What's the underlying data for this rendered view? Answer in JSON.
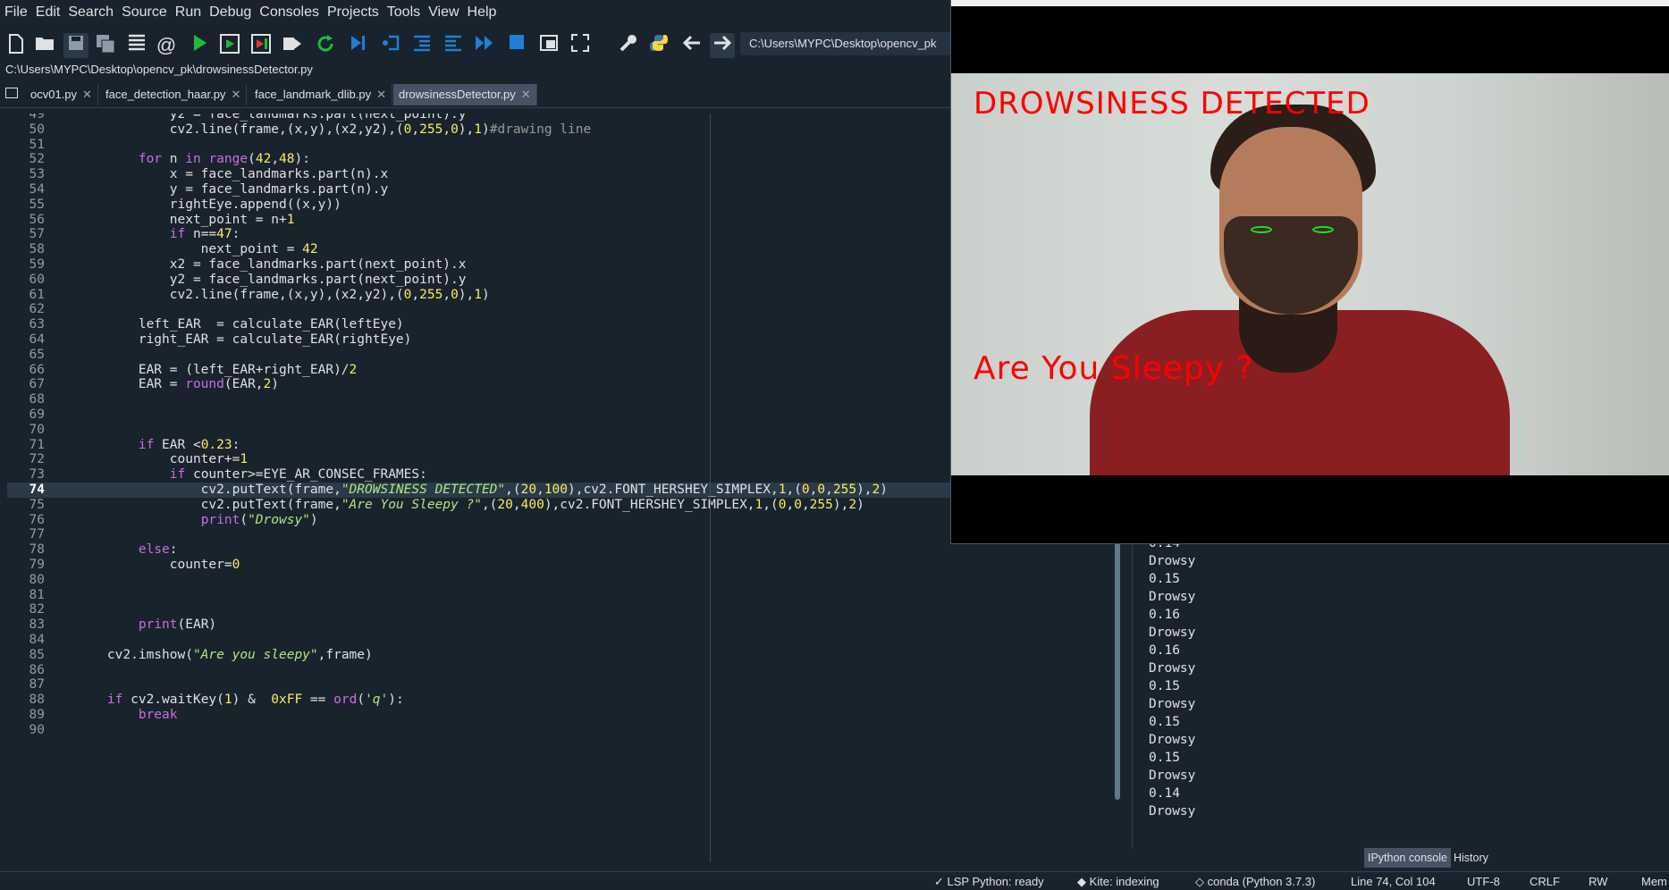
{
  "menu": [
    "File",
    "Edit",
    "Search",
    "Source",
    "Run",
    "Debug",
    "Consoles",
    "Projects",
    "Tools",
    "View",
    "Help"
  ],
  "toolbar": {
    "path": "C:\\Users\\MYPC\\Desktop\\opencv_pk"
  },
  "file_path": "C:\\Users\\MYPC\\Desktop\\opencv_pk\\drowsinessDetector.py",
  "tabs": [
    {
      "label": "ocv01.py"
    },
    {
      "label": "face_detection_haar.py"
    },
    {
      "label": "face_landmark_dlib.py"
    },
    {
      "label": "drowsinessDetector.py"
    }
  ],
  "tab_close": "✕",
  "editor": {
    "current_line": 74,
    "lines": [
      {
        "n": "49",
        "t": "            y2 = face_landmarks.part(next_point).y"
      },
      {
        "n": "50",
        "t": "            cv2.line(frame,(x,y),(x2,y2),(0,255,0),1)#drawing line"
      },
      {
        "n": "51",
        "t": ""
      },
      {
        "n": "52",
        "t": "        for n in range(42,48):"
      },
      {
        "n": "53",
        "t": "            x = face_landmarks.part(n).x"
      },
      {
        "n": "54",
        "t": "            y = face_landmarks.part(n).y"
      },
      {
        "n": "55",
        "t": "            rightEye.append((x,y))"
      },
      {
        "n": "56",
        "t": "            next_point = n+1"
      },
      {
        "n": "57",
        "t": "            if n==47:"
      },
      {
        "n": "58",
        "t": "                next_point = 42"
      },
      {
        "n": "59",
        "t": "            x2 = face_landmarks.part(next_point).x"
      },
      {
        "n": "60",
        "t": "            y2 = face_landmarks.part(next_point).y"
      },
      {
        "n": "61",
        "t": "            cv2.line(frame,(x,y),(x2,y2),(0,255,0),1)"
      },
      {
        "n": "62",
        "t": ""
      },
      {
        "n": "63",
        "t": "        left_EAR  = calculate_EAR(leftEye)"
      },
      {
        "n": "64",
        "t": "        right_EAR = calculate_EAR(rightEye)"
      },
      {
        "n": "65",
        "t": ""
      },
      {
        "n": "66",
        "t": "        EAR = (left_EAR+right_EAR)/2"
      },
      {
        "n": "67",
        "t": "        EAR = round(EAR,2)"
      },
      {
        "n": "68",
        "t": ""
      },
      {
        "n": "69",
        "t": ""
      },
      {
        "n": "70",
        "t": ""
      },
      {
        "n": "71",
        "t": "        if EAR <0.23:"
      },
      {
        "n": "72",
        "t": "            counter+=1"
      },
      {
        "n": "73",
        "t": "            if counter>=EYE_AR_CONSEC_FRAMES:"
      },
      {
        "n": "74",
        "t": "                cv2.putText(frame,\"DROWSINESS DETECTED\",(20,100),cv2.FONT_HERSHEY_SIMPLEX,1,(0,0,255),2)"
      },
      {
        "n": "75",
        "t": "                cv2.putText(frame,\"Are You Sleepy ?\",(20,400),cv2.FONT_HERSHEY_SIMPLEX,1,(0,0,255),2)"
      },
      {
        "n": "76",
        "t": "                print(\"Drowsy\")"
      },
      {
        "n": "77",
        "t": ""
      },
      {
        "n": "78",
        "t": "        else:"
      },
      {
        "n": "79",
        "t": "            counter=0"
      },
      {
        "n": "80",
        "t": ""
      },
      {
        "n": "81",
        "t": ""
      },
      {
        "n": "82",
        "t": ""
      },
      {
        "n": "83",
        "t": "        print(EAR)"
      },
      {
        "n": "84",
        "t": ""
      },
      {
        "n": "85",
        "t": "    cv2.imshow(\"Are you sleepy\",frame)"
      },
      {
        "n": "86",
        "t": ""
      },
      {
        "n": "87",
        "t": ""
      },
      {
        "n": "88",
        "t": "    if cv2.waitKey(1) &  0xFF == ord('q'):"
      },
      {
        "n": "89",
        "t": "        break"
      },
      {
        "n": "90",
        "t": ""
      }
    ]
  },
  "console": {
    "lines": [
      "0.14",
      "Drowsy",
      "0.15",
      "Drowsy",
      "0.16",
      "Drowsy",
      "0.16",
      "Drowsy",
      "0.15",
      "Drowsy",
      "0.15",
      "Drowsy",
      "0.15",
      "Drowsy",
      "0.14",
      "Drowsy"
    ],
    "tabs": [
      "IPython console",
      "History"
    ]
  },
  "video_window": {
    "overlay_top": "DROWSINESS DETECTED",
    "overlay_bottom": "Are You Sleepy ?",
    "overlay_color": "#ff0000",
    "eye_line_color": "#1fe01f"
  },
  "status": {
    "lsp": "LSP Python: ready",
    "kite": "Kite: indexing",
    "conda": "conda (Python 3.7.3)",
    "position": "Line 74, Col 104",
    "encoding": "UTF-8",
    "eol": "CRLF",
    "rw": "RW",
    "mem": "Mem"
  },
  "colors": {
    "background": "#19232d",
    "keyword": "#c670e0",
    "number": "#faed5c",
    "string": "#b0e686",
    "run_green": "#1fba3a",
    "stop_blue": "#1f7fd5"
  }
}
